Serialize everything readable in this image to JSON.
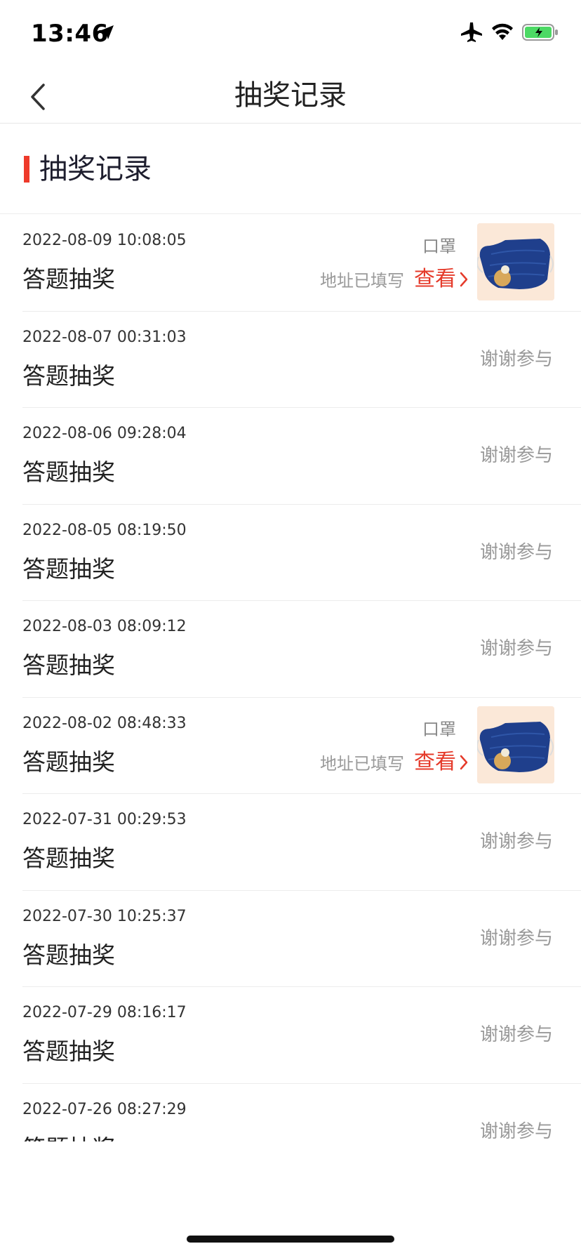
{
  "status_bar": {
    "time": "13:46",
    "icons": [
      "location-arrow-icon",
      "airplane-icon",
      "wifi-icon",
      "battery-charging-icon"
    ],
    "battery_color": "#4cd964"
  },
  "nav": {
    "back_icon": "chevron-left-icon",
    "title": "抽奖记录"
  },
  "section": {
    "title": "抽奖记录",
    "accent_color": "#ee3a2b"
  },
  "records": [
    {
      "time": "2022-08-09 10:08:05",
      "type": "答题抽奖",
      "prize": "口罩",
      "address_status": "地址已填写",
      "view_label": "查看"
    },
    {
      "time": "2022-08-07 00:31:03",
      "type": "答题抽奖",
      "result": "谢谢参与"
    },
    {
      "time": "2022-08-06 09:28:04",
      "type": "答题抽奖",
      "result": "谢谢参与"
    },
    {
      "time": "2022-08-05 08:19:50",
      "type": "答题抽奖",
      "result": "谢谢参与"
    },
    {
      "time": "2022-08-03 08:09:12",
      "type": "答题抽奖",
      "result": "谢谢参与"
    },
    {
      "time": "2022-08-02 08:48:33",
      "type": "答题抽奖",
      "prize": "口罩",
      "address_status": "地址已填写",
      "view_label": "查看"
    },
    {
      "time": "2022-07-31 00:29:53",
      "type": "答题抽奖",
      "result": "谢谢参与"
    },
    {
      "time": "2022-07-30 10:25:37",
      "type": "答题抽奖",
      "result": "谢谢参与"
    },
    {
      "time": "2022-07-29 08:16:17",
      "type": "答题抽奖",
      "result": "谢谢参与"
    },
    {
      "time": "2022-07-26 08:27:29",
      "type": "答题抽奖",
      "result": "谢谢参与"
    }
  ],
  "colors": {
    "view_link": "#e53a2a",
    "muted_text": "#999999",
    "thumb_bg": "#fbe8d8",
    "mask_blue": "#1f3f8c"
  }
}
